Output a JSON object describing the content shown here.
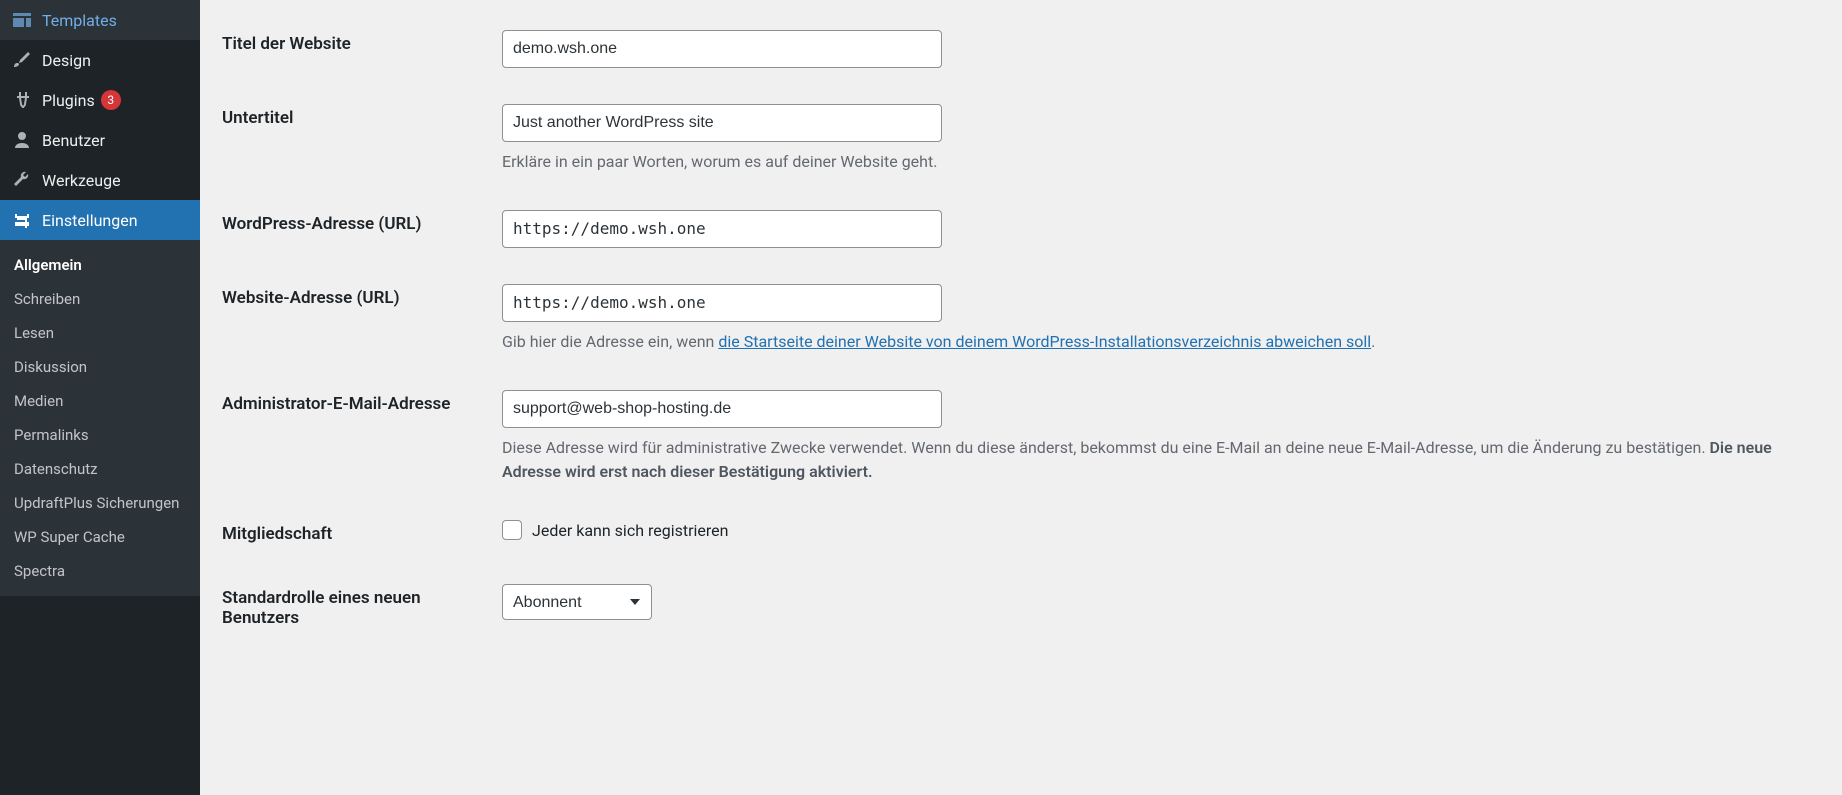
{
  "sidebar": {
    "menu": [
      {
        "label": "Templates",
        "icon": "templates"
      },
      {
        "label": "Design",
        "icon": "brush"
      },
      {
        "label": "Plugins",
        "icon": "plug",
        "badge": "3"
      },
      {
        "label": "Benutzer",
        "icon": "user"
      },
      {
        "label": "Werkzeuge",
        "icon": "wrench"
      },
      {
        "label": "Einstellungen",
        "icon": "sliders",
        "active": true
      }
    ],
    "submenu": [
      {
        "label": "Allgemein",
        "active": true
      },
      {
        "label": "Schreiben"
      },
      {
        "label": "Lesen"
      },
      {
        "label": "Diskussion"
      },
      {
        "label": "Medien"
      },
      {
        "label": "Permalinks"
      },
      {
        "label": "Datenschutz"
      },
      {
        "label": "UpdraftPlus Sicherungen"
      },
      {
        "label": "WP Super Cache"
      },
      {
        "label": "Spectra"
      }
    ]
  },
  "form": {
    "site_title": {
      "label": "Titel der Website",
      "value": "demo.wsh.one"
    },
    "tagline": {
      "label": "Untertitel",
      "value": "Just another WordPress site",
      "help": "Erkläre in ein paar Worten, worum es auf deiner Website geht."
    },
    "wp_url": {
      "label": "WordPress-Adresse (URL)",
      "value": "https://demo.wsh.one"
    },
    "site_url": {
      "label": "Website-Adresse (URL)",
      "value": "https://demo.wsh.one",
      "help_pre": "Gib hier die Adresse ein, wenn ",
      "help_link": "die Startseite deiner Website von deinem WordPress-Installationsverzeichnis abweichen soll",
      "help_post": "."
    },
    "admin_email": {
      "label": "Administrator-E-Mail-Adresse",
      "value": "support@web-shop-hosting.de",
      "help_pre": "Diese Adresse wird für administrative Zwecke verwendet. Wenn du diese änderst, bekommst du eine E-Mail an deine neue E-Mail-Adresse, um die Änderung zu bestätigen. ",
      "help_strong": "Die neue Adresse wird erst nach dieser Bestätigung aktiviert."
    },
    "membership": {
      "label": "Mitgliedschaft",
      "checkbox_label": "Jeder kann sich registrieren"
    },
    "default_role": {
      "label": "Standardrolle eines neuen Benutzers",
      "value": "Abonnent"
    }
  }
}
